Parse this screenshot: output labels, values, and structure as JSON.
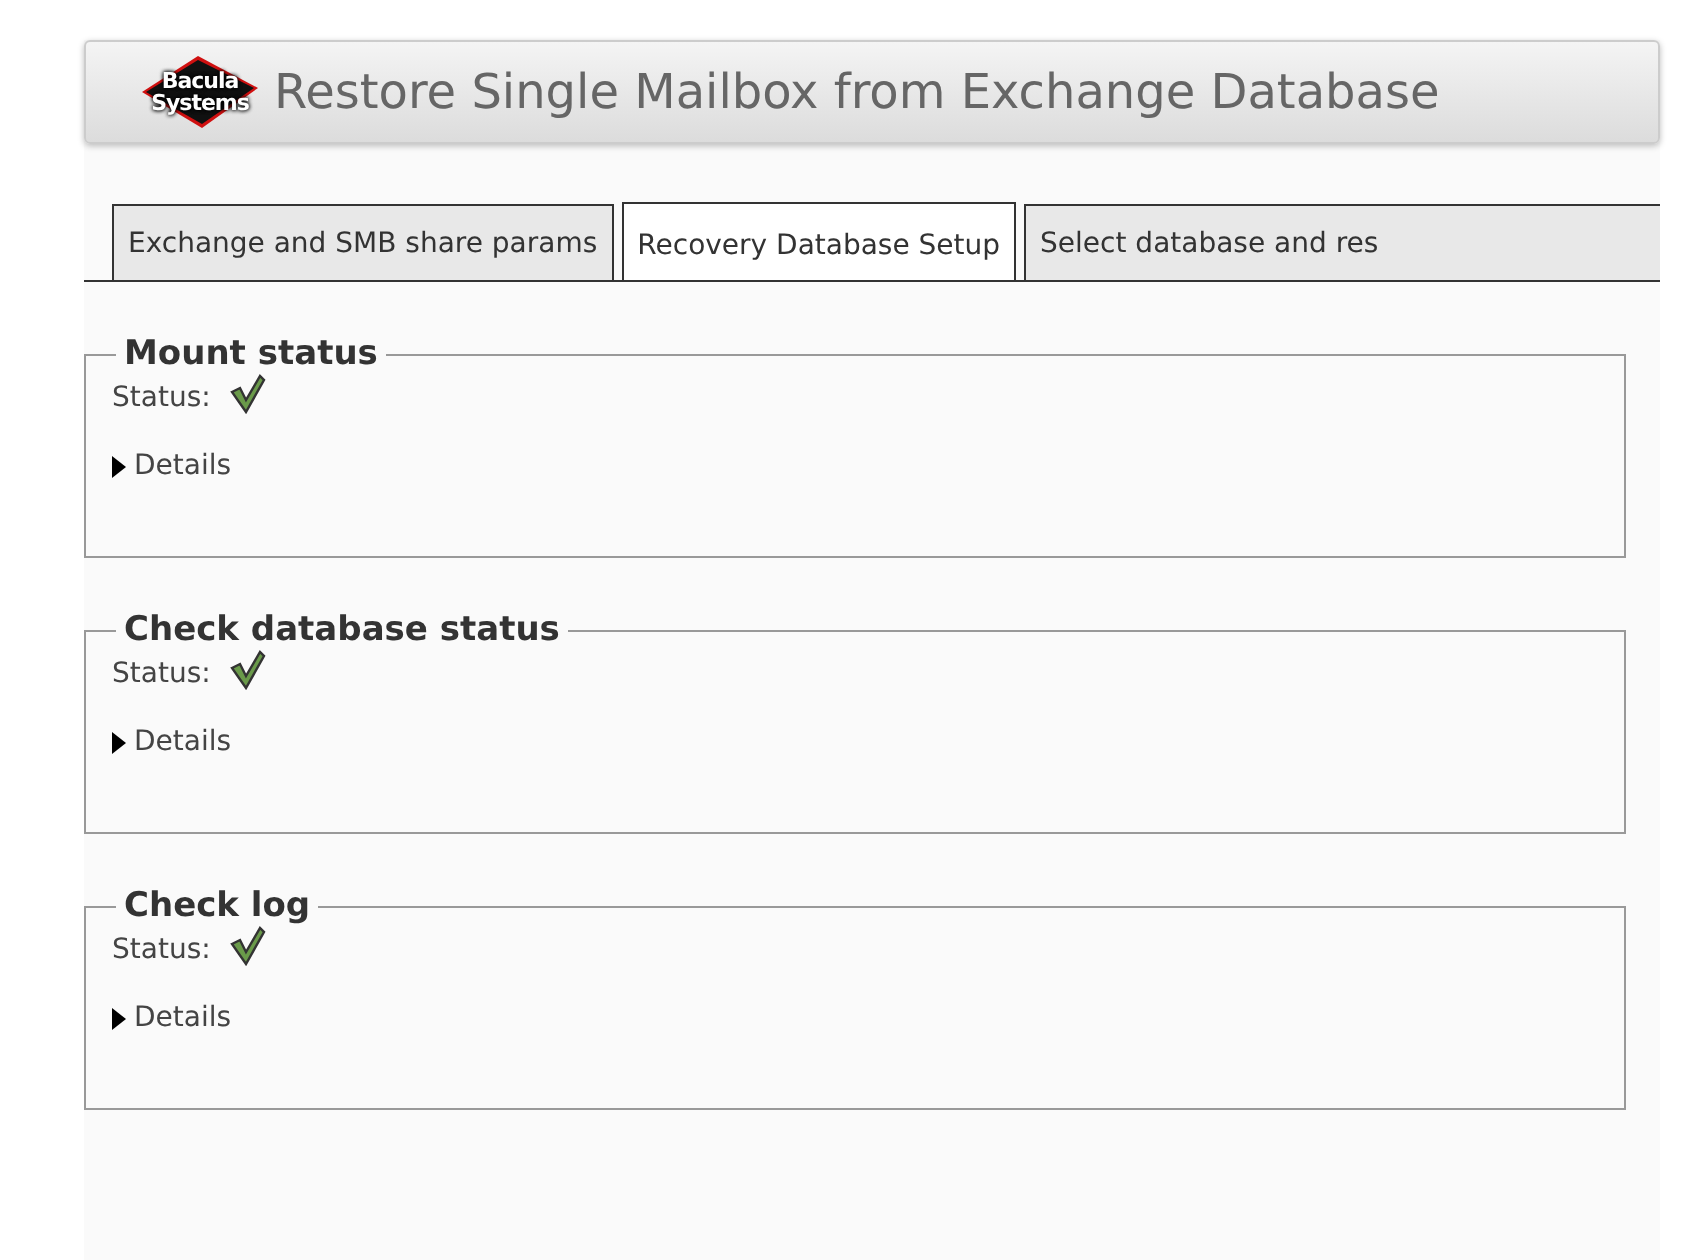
{
  "header": {
    "logo": {
      "line_1": "Bacula",
      "line_2": "Systems"
    },
    "title": "Restore Single Mailbox from Exchange Database"
  },
  "tabs": [
    {
      "label": "Exchange and SMB share params",
      "selected": false
    },
    {
      "label": "Recovery Database Setup",
      "selected": true
    },
    {
      "label": "Select database and res",
      "selected": false
    }
  ],
  "panels": [
    {
      "title": "Mount status",
      "status_label": "Status:",
      "ok": true,
      "details": {
        "label": "Details",
        "expanded": false
      }
    },
    {
      "title": "Check database status",
      "status_label": "Status:",
      "ok": true,
      "details": {
        "label": "Details",
        "expanded": false
      }
    },
    {
      "title": "Check log",
      "status_label": "Status:",
      "ok": true,
      "details": {
        "label": "Details",
        "expanded": false
      }
    }
  ]
}
